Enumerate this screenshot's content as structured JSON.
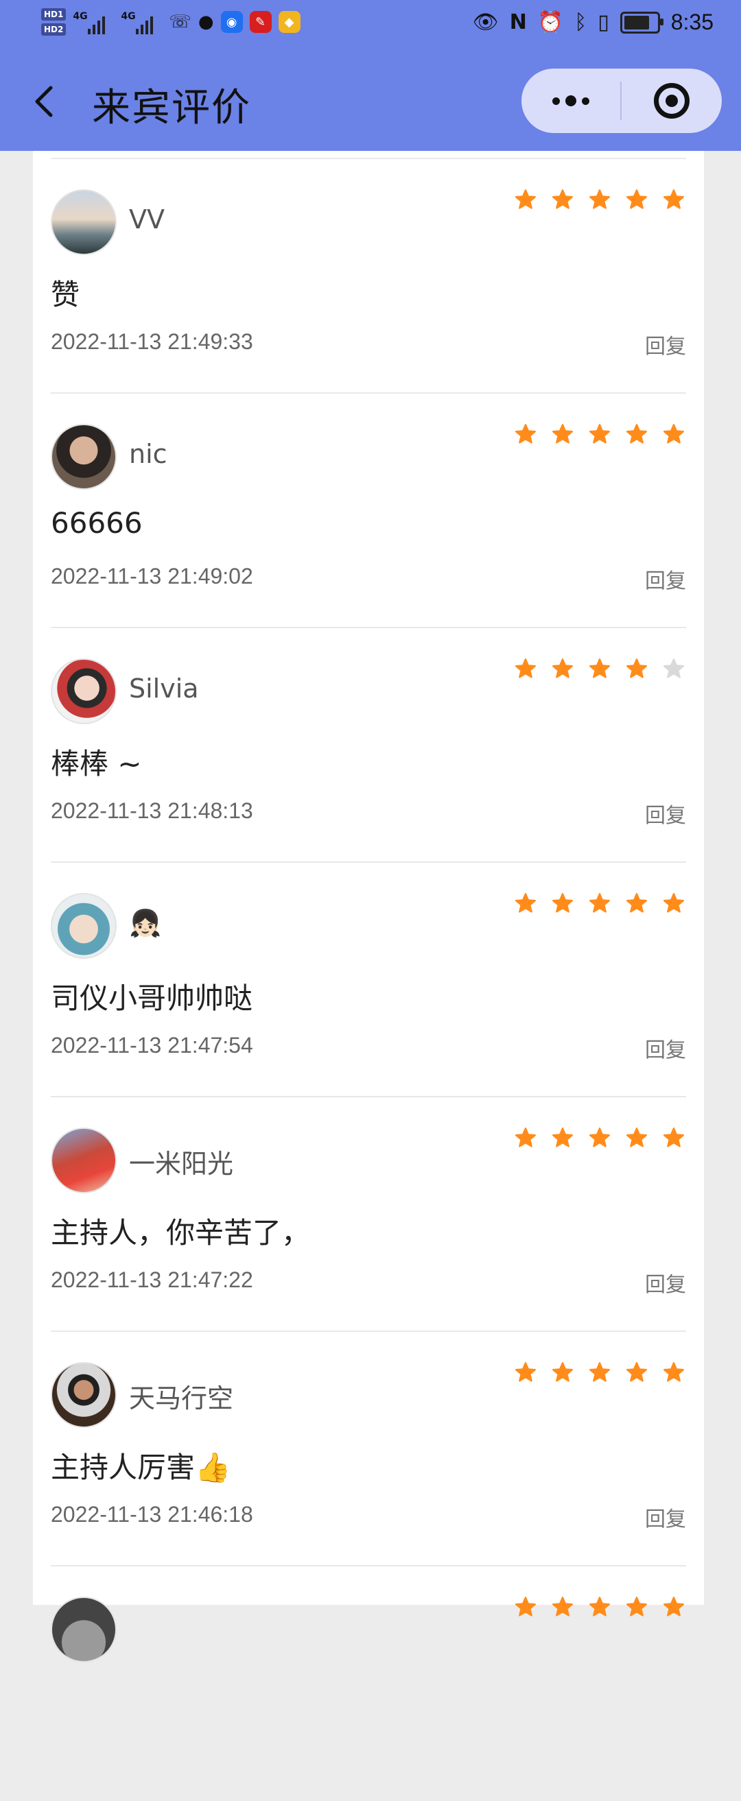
{
  "status_bar": {
    "sim1": "HD",
    "sim1_num": "1",
    "sim2": "HD",
    "sim2_num": "2",
    "network1": "4G",
    "network2": "4G",
    "time": "8:35",
    "icons": [
      "missed-call-icon",
      "wechat-icon",
      "bulb-app-icon",
      "study-app-icon",
      "diamond-app-icon",
      "eye-icon",
      "nfc-icon",
      "alarm-icon",
      "bluetooth-icon",
      "vibrate-icon",
      "battery-icon"
    ]
  },
  "header": {
    "title": "来宾评价",
    "background": "#6b82e6"
  },
  "reviews": [
    {
      "name": "VV",
      "rating": 5,
      "comment": "赞",
      "time": "2022-11-13 21:49:33",
      "reply_label": "回复"
    },
    {
      "name": "nic",
      "rating": 5,
      "comment": "66666",
      "time": "2022-11-13 21:49:02",
      "reply_label": "回复"
    },
    {
      "name": "Silvia",
      "rating": 4,
      "comment": "棒棒 ~",
      "time": "2022-11-13 21:48:13",
      "reply_label": "回复"
    },
    {
      "name": "👧🏻",
      "rating": 5,
      "comment": "司仪小哥帅帅哒",
      "time": "2022-11-13 21:47:54",
      "reply_label": "回复"
    },
    {
      "name": "一米阳光",
      "rating": 5,
      "comment": "主持人，你辛苦了，",
      "time": "2022-11-13 21:47:22",
      "reply_label": "回复"
    },
    {
      "name": "天马行空",
      "rating": 5,
      "comment": "主持人厉害👍",
      "time": "2022-11-13 21:46:18",
      "reply_label": "回复"
    },
    {
      "name": "",
      "rating": 5,
      "comment": "",
      "time": "",
      "reply_label": ""
    }
  ],
  "colors": {
    "star_on": "#ff8c1a",
    "star_off": "#d9d9d9"
  }
}
